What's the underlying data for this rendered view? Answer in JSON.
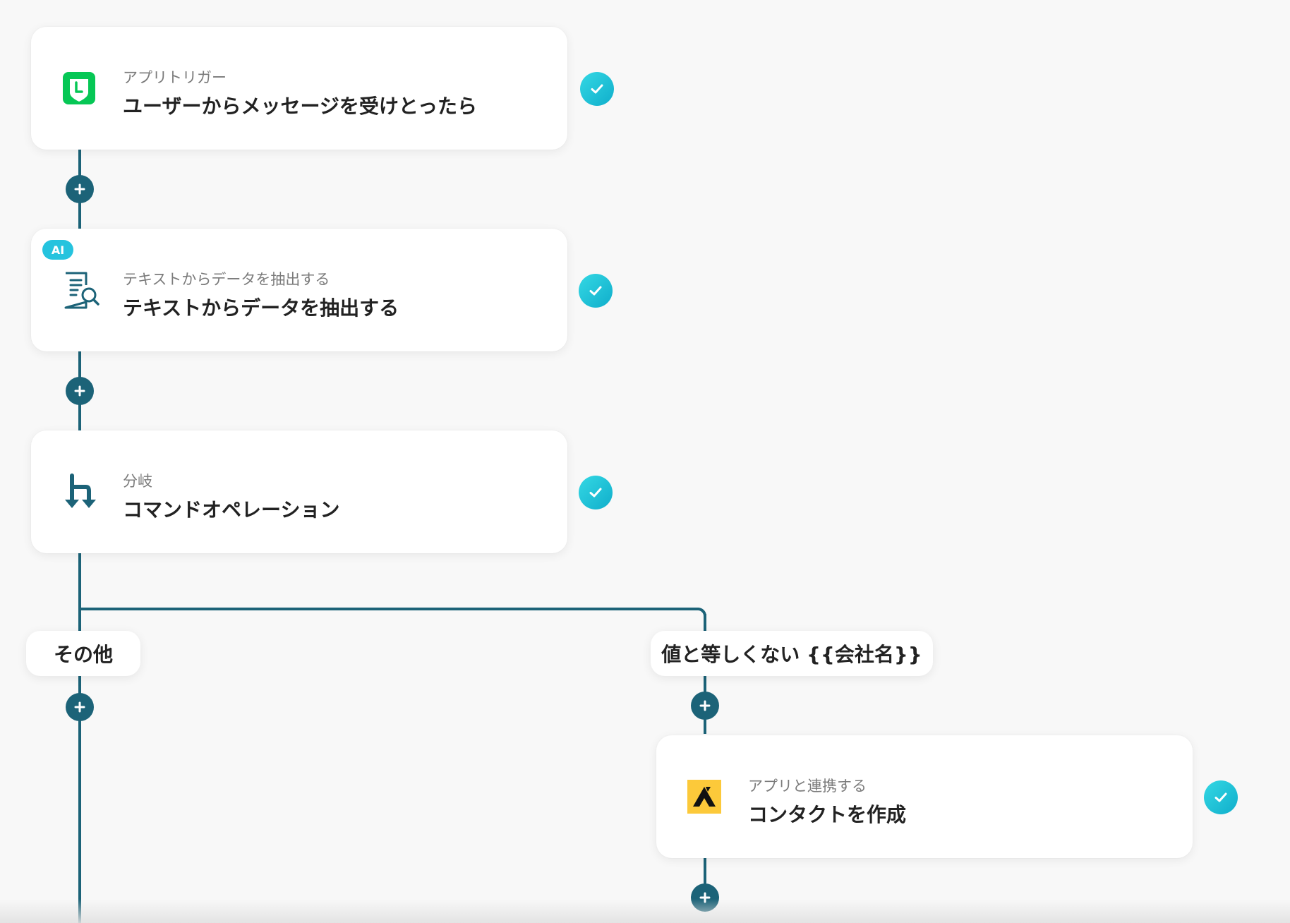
{
  "steps": [
    {
      "subtitle": "アプリトリガー",
      "title": "ユーザーからメッセージを受けとったら",
      "icon": "line-app-icon"
    },
    {
      "subtitle": "テキストからデータを抽出する",
      "title": "テキストからデータを抽出する",
      "icon": "document-search-icon",
      "badge": "AI"
    },
    {
      "subtitle": "分岐",
      "title": "コマンドオペレーション",
      "icon": "branch-icon"
    },
    {
      "subtitle": "アプリと連携する",
      "title": "コンタクトを作成",
      "icon": "attio-app-icon"
    }
  ],
  "branches": {
    "left_label": "その他",
    "right_label": "値と等しくない {{会社名}}"
  },
  "colors": {
    "connector": "#1c6378",
    "check": "#1fc4d8",
    "ai_badge": "#25c3de",
    "line_green": "#06c755",
    "attio_yellow": "#fcc93a"
  }
}
